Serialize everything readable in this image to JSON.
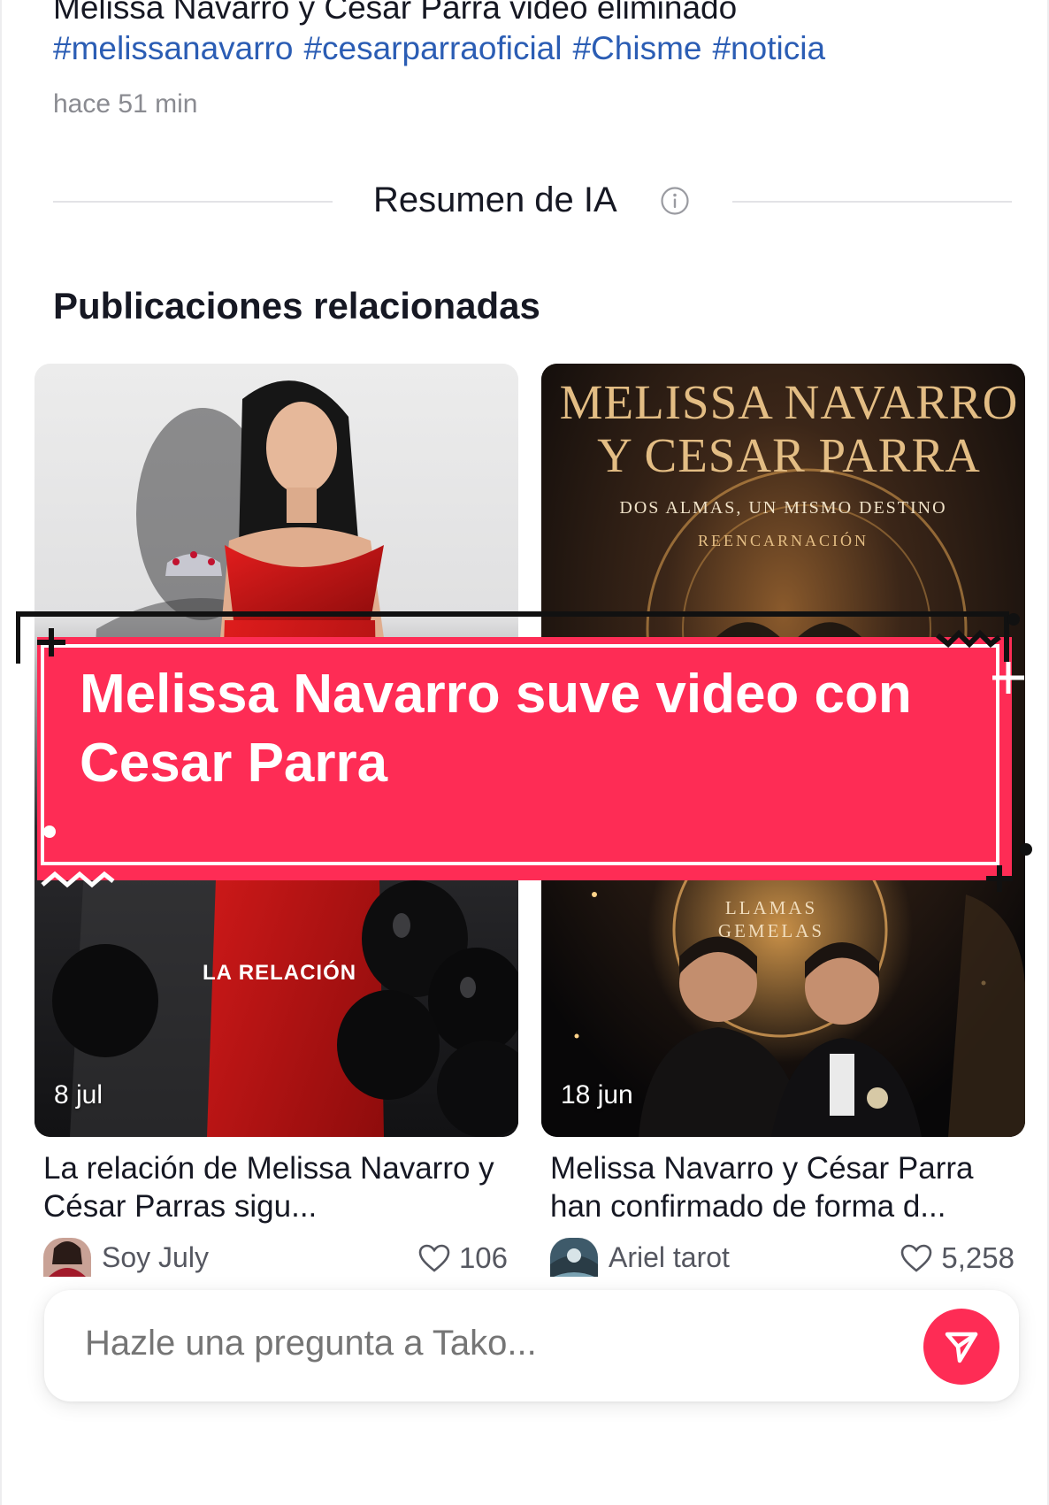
{
  "post": {
    "title": "Melissa Navarro y César Parra video eliminado",
    "hashtags": [
      "#melissanavarro",
      "#cesarparraoficial",
      "#Chisme",
      "#noticia"
    ],
    "timestamp": "hace 51 min"
  },
  "ai_summary": {
    "label": "Resumen de IA",
    "icon": "info-icon"
  },
  "related": {
    "heading": "Publicaciones relacionadas",
    "cards": [
      {
        "thumb_text": "LA RELACIÓN",
        "date": "8 jul",
        "description": "La relación de Melissa Navarro y César Parras sigu...",
        "author": "Soy July",
        "likes": "106"
      },
      {
        "thumb_title_line1": "MELISSA NAVARRO",
        "thumb_title_line2": "Y CESAR PARRA",
        "thumb_subtitle": "DOS ALMAS, UN MISMO DESTINO",
        "thumb_tag": "REENCARNACIÓN",
        "thumb_caption": "LLAMAS GEMELAS",
        "date": "18 jun",
        "description": "Melissa Navarro y César Parra han confirmado de forma d...",
        "author": "Ariel tarot",
        "likes": "5,258"
      }
    ]
  },
  "overlay_banner": {
    "text": "Melissa Navarro suve video con Cesar Parra"
  },
  "ask": {
    "placeholder": "Hazle una pregunta a Tako...",
    "send_icon": "send-icon"
  },
  "colors": {
    "accent": "#fe2c55",
    "hashtag": "#2b5db4",
    "muted": "#8a8b91"
  }
}
